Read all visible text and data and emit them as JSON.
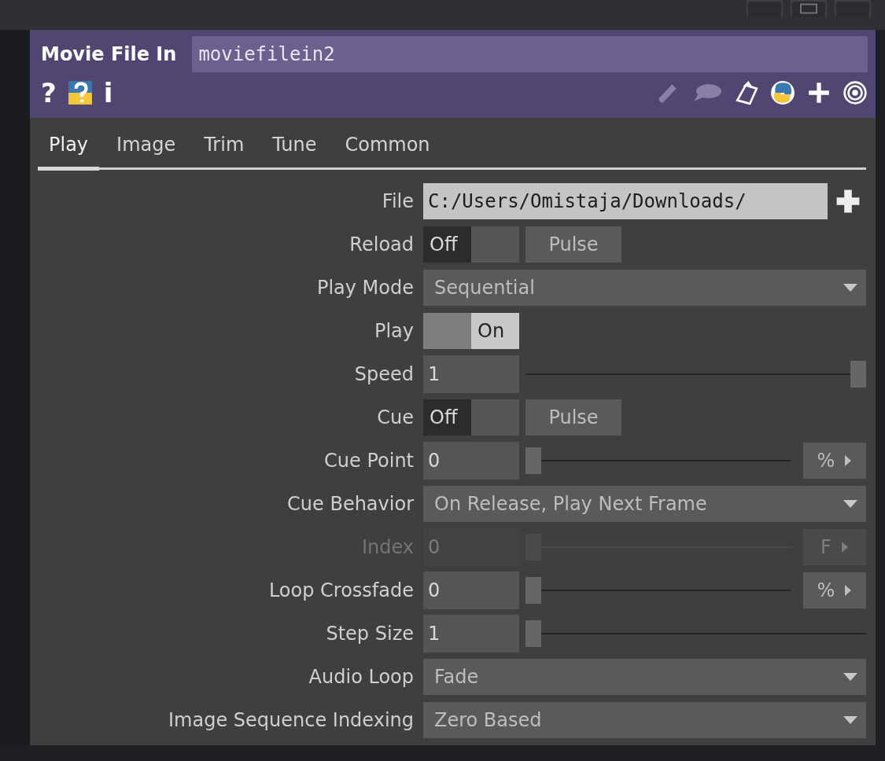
{
  "header": {
    "type": "Movie File In",
    "name": "moviefilein2",
    "help_buttons": [
      "?",
      "i"
    ]
  },
  "tabs": [
    {
      "label": "Play",
      "selected": true
    },
    {
      "label": "Image",
      "selected": false
    },
    {
      "label": "Trim",
      "selected": false
    },
    {
      "label": "Tune",
      "selected": false
    },
    {
      "label": "Common",
      "selected": false
    }
  ],
  "params": [
    {
      "kind": "file",
      "label": "File",
      "value": "C:/Users/Omistaja/Downloads/"
    },
    {
      "kind": "toggle",
      "label": "Reload",
      "on": false,
      "off_text": "Off",
      "button": "Pulse"
    },
    {
      "kind": "menu",
      "label": "Play Mode",
      "value": "Sequential"
    },
    {
      "kind": "toggle",
      "label": "Play",
      "on": true,
      "on_text": "On"
    },
    {
      "kind": "slider",
      "label": "Speed",
      "value": "1",
      "level": 1,
      "disabled": false
    },
    {
      "kind": "toggle",
      "label": "Cue",
      "on": false,
      "off_text": "Off",
      "button": "Pulse"
    },
    {
      "kind": "slider",
      "label": "Cue Point",
      "value": "0",
      "level": 0,
      "unit": "%",
      "disabled": false
    },
    {
      "kind": "menu",
      "label": "Cue Behavior",
      "value": "On Release, Play Next Frame"
    },
    {
      "kind": "slider",
      "label": "Index",
      "value": "0",
      "level": 0,
      "unit": "F",
      "disabled": true
    },
    {
      "kind": "slider",
      "label": "Loop Crossfade",
      "value": "0",
      "level": 0,
      "unit": "%",
      "disabled": false
    },
    {
      "kind": "slider",
      "label": "Step Size",
      "value": "1",
      "level": 0,
      "disabled": false
    },
    {
      "kind": "menu",
      "label": "Audio Loop",
      "value": "Fade"
    },
    {
      "kind": "menu",
      "label": "Image Sequence Indexing",
      "value": "Zero Based"
    }
  ]
}
